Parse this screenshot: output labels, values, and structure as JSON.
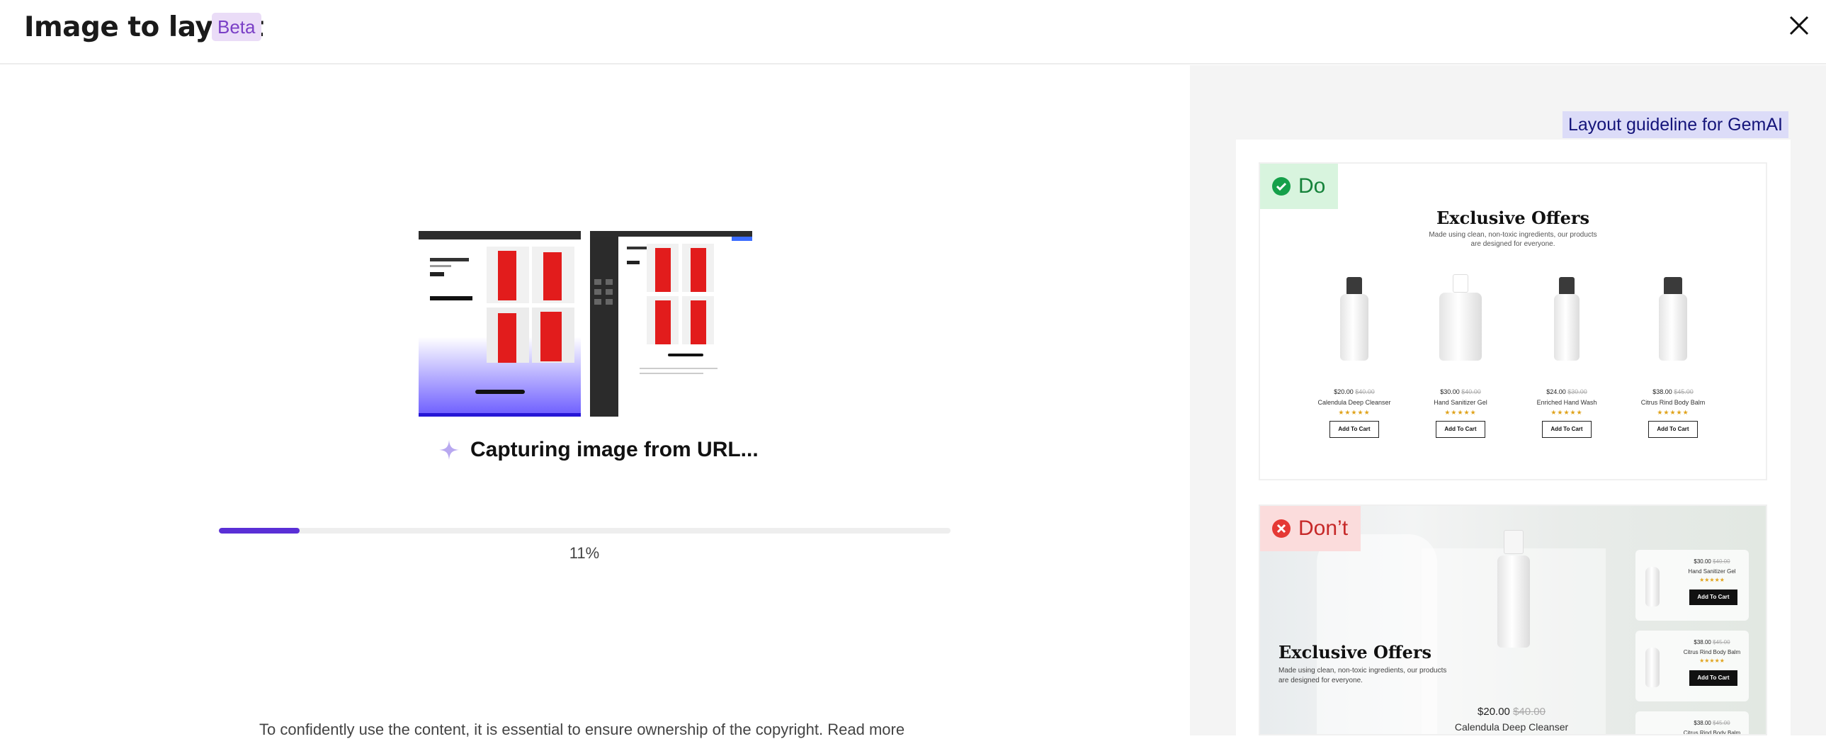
{
  "header": {
    "title": "Image to layout",
    "badge": "Beta"
  },
  "progress": {
    "caption": "Capturing image from URL...",
    "percent_label": "11%",
    "value": 0.11
  },
  "footnote": "To confidently use the content, it is essential to ensure ownership of the copyright. Read more",
  "guideline": {
    "label": "Layout guideline for GemAI",
    "do_label": "Do",
    "dont_label": "Don’t"
  },
  "do_example": {
    "title": "Exclusive Offers",
    "subtitle_lines": [
      "Made using clean, non-toxic ingredients, our products",
      "are designed for everyone."
    ],
    "products": [
      {
        "price": "$20.00",
        "old_price": "$40.00",
        "name": "Calendula Deep Cleanser",
        "stars": "★★★★★",
        "button": "Add To Cart"
      },
      {
        "price": "$30.00",
        "old_price": "$40.00",
        "name": "Hand Sanitizer Gel",
        "stars": "★★★★★",
        "button": "Add To Cart"
      },
      {
        "price": "$24.00",
        "old_price": "$30.00",
        "name": "Enriched Hand Wash",
        "stars": "★★★★★",
        "button": "Add To Cart"
      },
      {
        "price": "$38.00",
        "old_price": "$45.00",
        "name": "Citrus Rind Body Balm",
        "stars": "★★★★★",
        "button": "Add To Cart"
      }
    ]
  },
  "dont_example": {
    "title": "Exclusive Offers",
    "subtitle_lines": [
      "Made using clean, non-toxic ingredients, our products",
      "are designed for everyone."
    ],
    "main_price": "$20.00",
    "main_old_price": "$40.00",
    "main_name": "Calendula Deep Cleanser",
    "side_products": [
      {
        "price": "$30.00",
        "old_price": "$40.00",
        "name": "Hand Sanitizer Gel",
        "stars": "★★★★★",
        "button": "Add To Cart"
      },
      {
        "price": "$38.00",
        "old_price": "$45.00",
        "name": "Citrus Rind Body Balm",
        "stars": "★★★★★",
        "button": "Add To Cart"
      },
      {
        "price": "$38.00",
        "old_price": "$45.00",
        "name": "Citrus Rind Body Balm"
      }
    ]
  },
  "colors": {
    "accent": "#5a2fd6",
    "beta_bg": "#eadcf7",
    "do_green": "#15823a",
    "dont_red": "#c62828"
  }
}
